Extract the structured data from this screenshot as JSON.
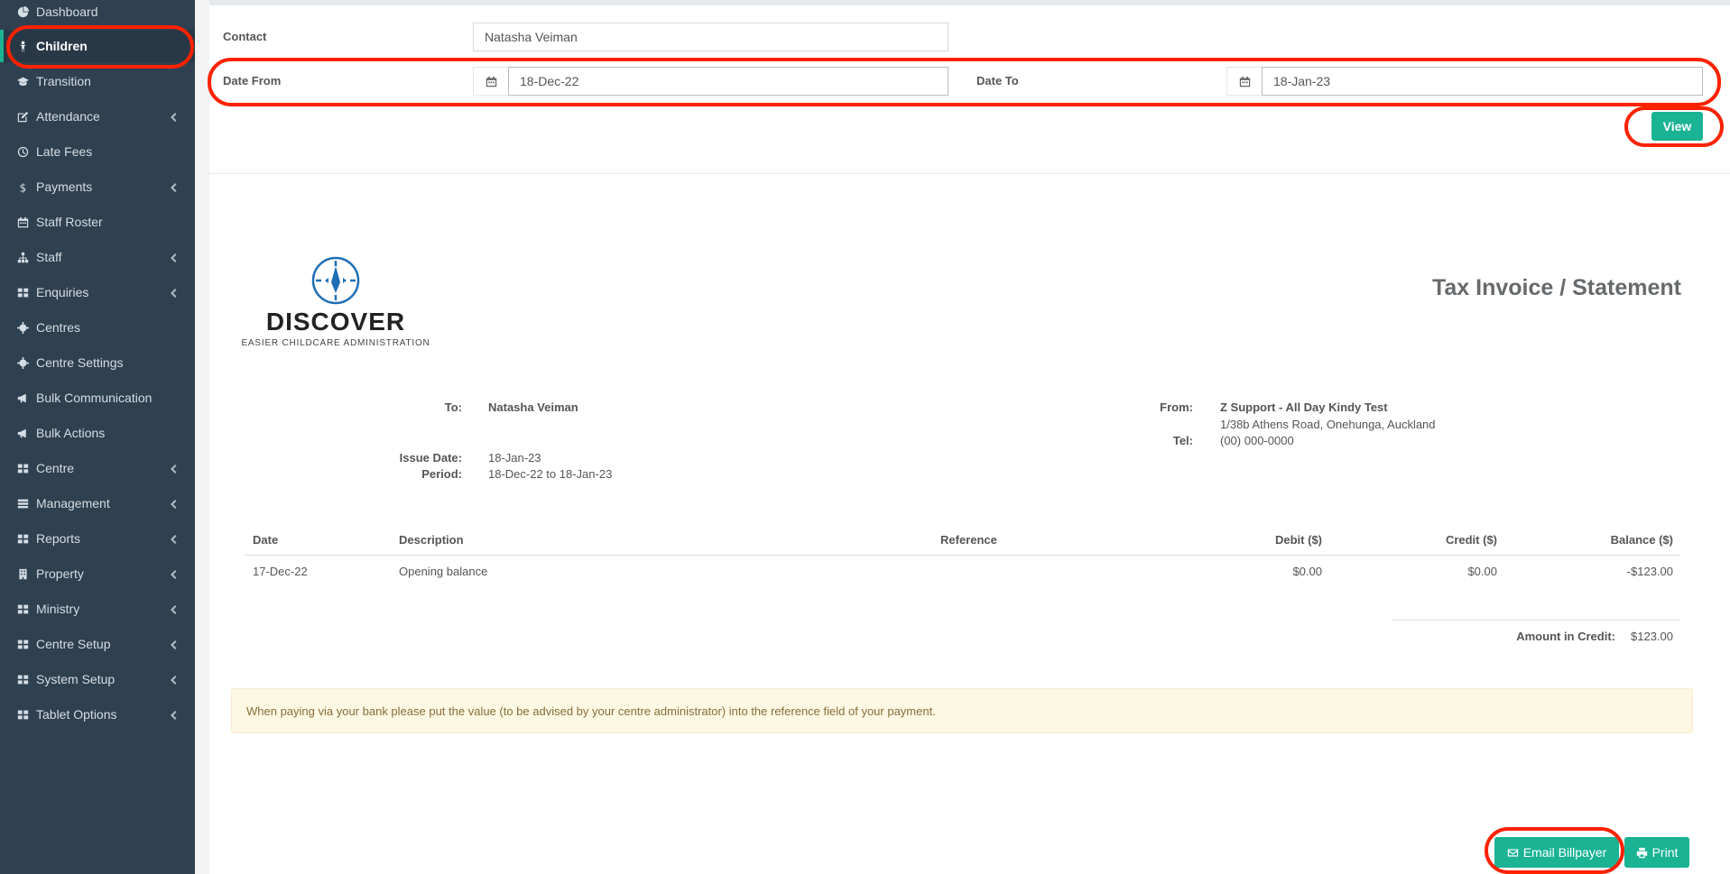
{
  "sidebar": {
    "items": [
      {
        "label": "Dashboard",
        "icon": "dashboard-icon",
        "has_arrow": false
      },
      {
        "label": "Children",
        "icon": "child-icon",
        "has_arrow": false,
        "active": true
      },
      {
        "label": "Transition",
        "icon": "graduation-cap-icon",
        "has_arrow": false
      },
      {
        "label": "Attendance",
        "icon": "edit-icon",
        "has_arrow": true
      },
      {
        "label": "Late Fees",
        "icon": "clock-icon",
        "has_arrow": false
      },
      {
        "label": "Payments",
        "icon": "dollar-icon",
        "has_arrow": true
      },
      {
        "label": "Staff Roster",
        "icon": "calendar-icon",
        "has_arrow": false
      },
      {
        "label": "Staff",
        "icon": "sitemap-icon",
        "has_arrow": true
      },
      {
        "label": "Enquiries",
        "icon": "grid-icon",
        "has_arrow": true
      },
      {
        "label": "Centres",
        "icon": "gear-icon",
        "has_arrow": false
      },
      {
        "label": "Centre Settings",
        "icon": "gear-icon",
        "has_arrow": false
      },
      {
        "label": "Bulk Communication",
        "icon": "bullhorn-icon",
        "has_arrow": false
      },
      {
        "label": "Bulk Actions",
        "icon": "bullhorn-icon",
        "has_arrow": false
      },
      {
        "label": "Centre",
        "icon": "grid-icon",
        "has_arrow": true
      },
      {
        "label": "Management",
        "icon": "tasks-icon",
        "has_arrow": true
      },
      {
        "label": "Reports",
        "icon": "grid-icon",
        "has_arrow": true
      },
      {
        "label": "Property",
        "icon": "building-icon",
        "has_arrow": true
      },
      {
        "label": "Ministry",
        "icon": "grid-icon",
        "has_arrow": true
      },
      {
        "label": "Centre Setup",
        "icon": "grid-icon",
        "has_arrow": true
      },
      {
        "label": "System Setup",
        "icon": "grid-icon",
        "has_arrow": true
      },
      {
        "label": "Tablet Options",
        "icon": "grid-icon",
        "has_arrow": true
      }
    ]
  },
  "filters": {
    "contact_label": "Contact",
    "contact_value": "Natasha Veiman",
    "date_from_label": "Date From",
    "date_from_value": "18-Dec-22",
    "date_to_label": "Date To",
    "date_to_value": "18-Jan-23",
    "view_button": "View"
  },
  "logo": {
    "word": "DISCOVER",
    "tagline": "EASIER CHILDCARE ADMINISTRATION"
  },
  "invoice": {
    "title": "Tax Invoice / Statement",
    "to_label": "To:",
    "to_value": "Natasha Veiman",
    "issue_date_label": "Issue Date:",
    "issue_date_value": "18-Jan-23",
    "period_label": "Period:",
    "period_value": "18-Dec-22 to 18-Jan-23",
    "from_label": "From:",
    "from_name": "Z Support - All Day Kindy Test",
    "from_address": "1/38b Athens Road, Onehunga, Auckland",
    "tel_label": "Tel:",
    "tel_value": "(00) 000-0000"
  },
  "table": {
    "headers": [
      "Date",
      "Description",
      "Reference",
      "Debit ($)",
      "Credit ($)",
      "Balance ($)"
    ],
    "rows": [
      {
        "date": "17-Dec-22",
        "description": "Opening balance",
        "reference": "",
        "debit": "$0.00",
        "credit": "$0.00",
        "balance": "-$123.00"
      }
    ],
    "summary_label": "Amount in Credit:",
    "summary_value": "$123.00"
  },
  "notice": "When paying via your bank please put the value (to be advised by your centre administrator) into the reference field of your payment.",
  "actions": {
    "email_button": "Email Billpayer",
    "print_button": "Print"
  },
  "colors": {
    "sidebar": "#2f4050",
    "accent": "#1ab394",
    "highlight": "#ff2200",
    "notice_bg": "#fcf8e3"
  }
}
